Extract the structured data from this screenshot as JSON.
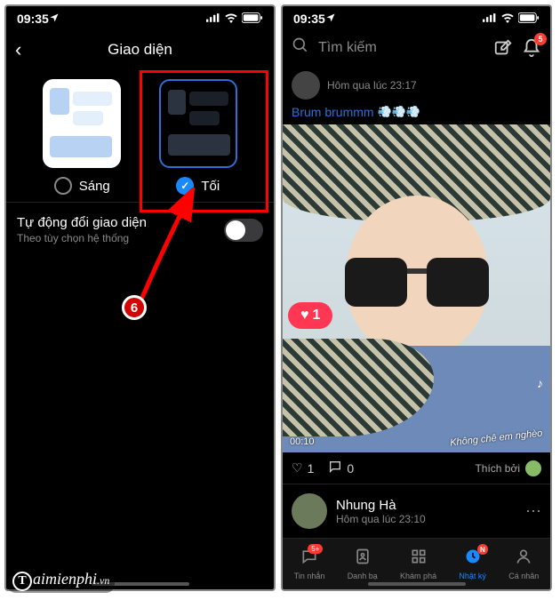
{
  "status": {
    "time": "09:35",
    "signal_icon": "signal-icon",
    "wifi_icon": "wifi-icon",
    "battery_icon": "battery-icon",
    "location_icon": "location-arrow-icon"
  },
  "left": {
    "header_title": "Giao diện",
    "light_label": "Sáng",
    "dark_label": "Tối",
    "auto_title": "Tự động đổi giao diện",
    "auto_subtitle": "Theo tùy chọn hệ thống",
    "step_number": "6",
    "selected": "dark"
  },
  "right": {
    "search_placeholder": "Tìm kiếm",
    "bell_count": "5",
    "post1": {
      "time_label": "Hôm qua lúc 23:17",
      "caption": "Brum brummm",
      "like_pill": "1",
      "video_elapsed": "00:10",
      "video_caption": "Không chê em nghèo",
      "like_count": "1",
      "comment_count": "0",
      "liked_by_label": "Thích bởi"
    },
    "post2": {
      "name": "Nhung Hà",
      "time_label": "Hôm qua lúc 23:10"
    },
    "nav": {
      "messages": "Tin nhắn",
      "messages_badge": "5+",
      "contacts": "Danh bạ",
      "discover": "Khám phá",
      "timeline": "Nhật ký",
      "timeline_badge": "N",
      "me": "Cá nhân"
    }
  },
  "watermark": {
    "text": "aimienphi",
    "suffix": ".vn",
    "letter": "T"
  }
}
